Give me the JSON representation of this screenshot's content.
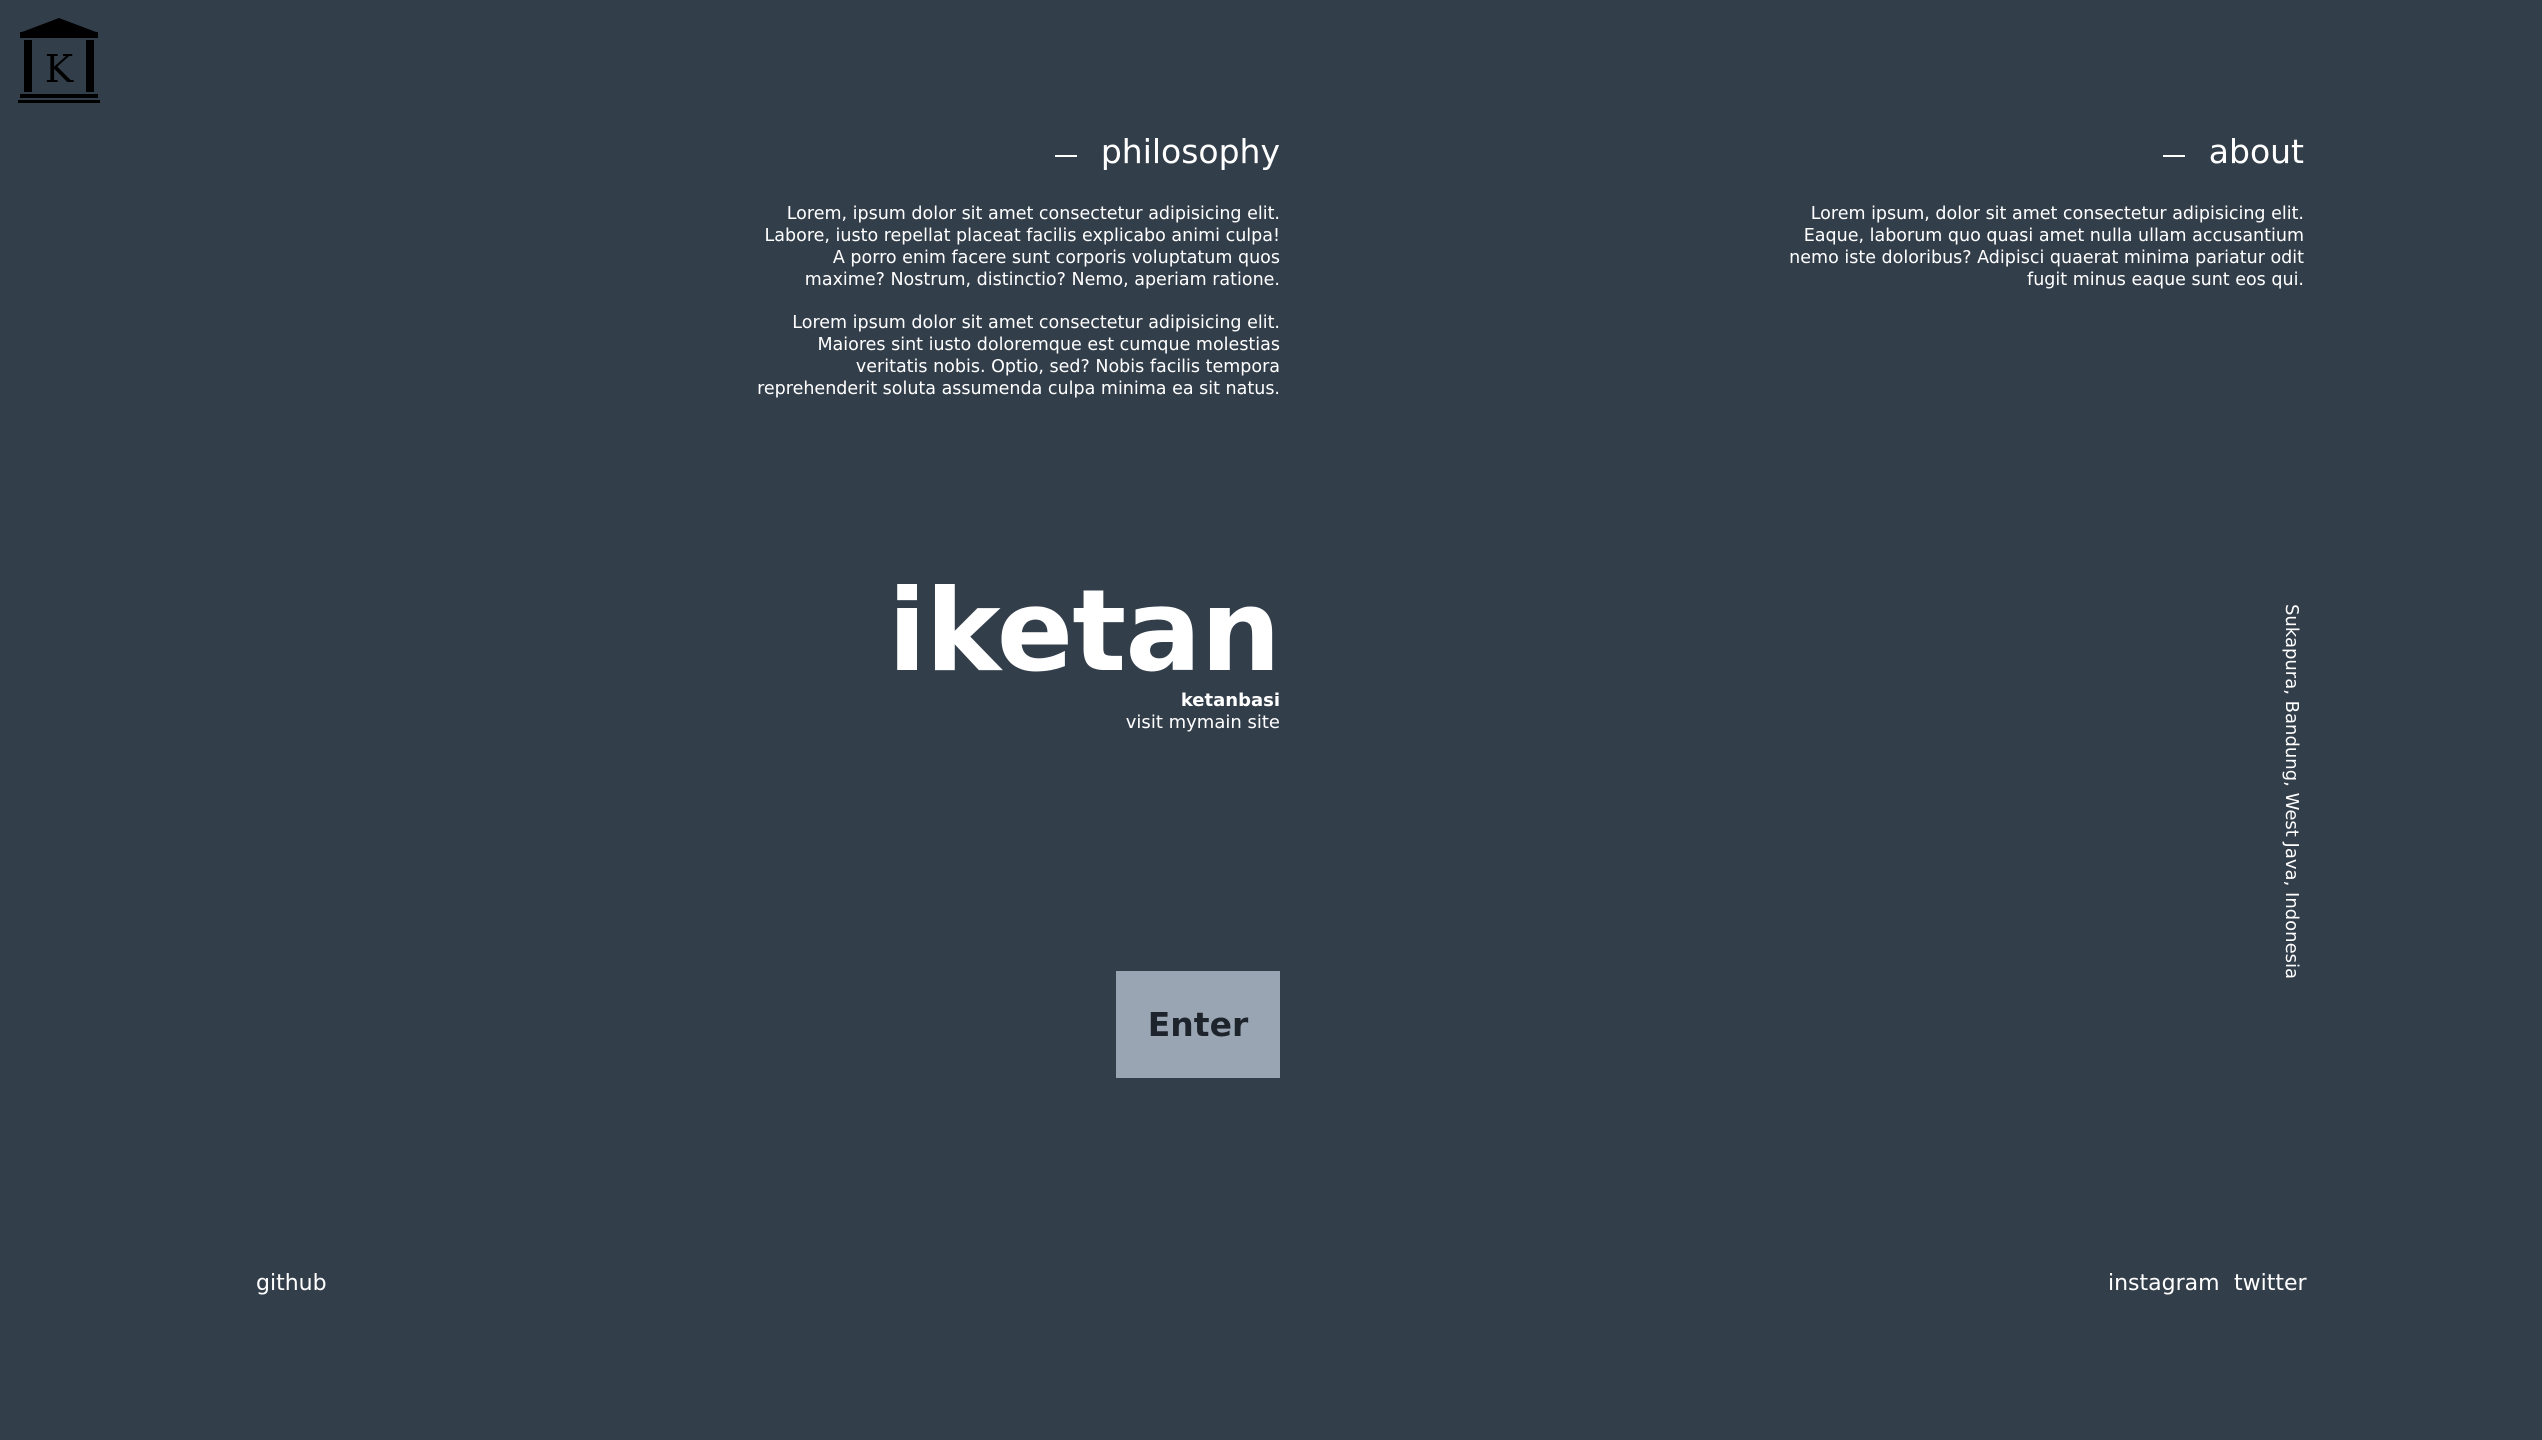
{
  "logo": {
    "icon": "temple-k-logo",
    "letter": "K"
  },
  "philosophy": {
    "heading": "philosophy",
    "paragraphs": [
      "Lorem, ipsum dolor sit amet consectetur adipisicing elit. Labore, iusto repellat placeat facilis explicabo animi culpa! A porro enim facere sunt corporis voluptatum quos maxime? Nostrum, distinctio? Nemo, aperiam ratione.",
      "Lorem ipsum dolor sit amet consectetur adipisicing elit. Maiores sint iusto doloremque est cumque molestias veritatis nobis. Optio, sed? Nobis facilis tempora reprehenderit soluta assumenda culpa minima ea sit natus."
    ]
  },
  "about": {
    "heading": "about",
    "paragraphs": [
      "Lorem ipsum, dolor sit amet consectetur adipisicing elit. Eaque, laborum quo quasi amet nulla ullam accusantium nemo iste doloribus? Adipisci quaerat minima pariatur odit fugit minus eaque sunt eos qui."
    ]
  },
  "brand": {
    "title": "iketan",
    "subtitle": "ketanbasi",
    "link": "visit mymain site"
  },
  "enter_button": {
    "label": "Enter"
  },
  "location": "Sukapura, Bandung, West Java, Indonesia",
  "footer": {
    "left": [
      "github"
    ],
    "right": [
      "instagram",
      "twitter"
    ]
  },
  "colors": {
    "background": "#333e4b",
    "text": "#ffffff",
    "button_bg": "#9aa5b4",
    "button_text": "#1e242c"
  }
}
